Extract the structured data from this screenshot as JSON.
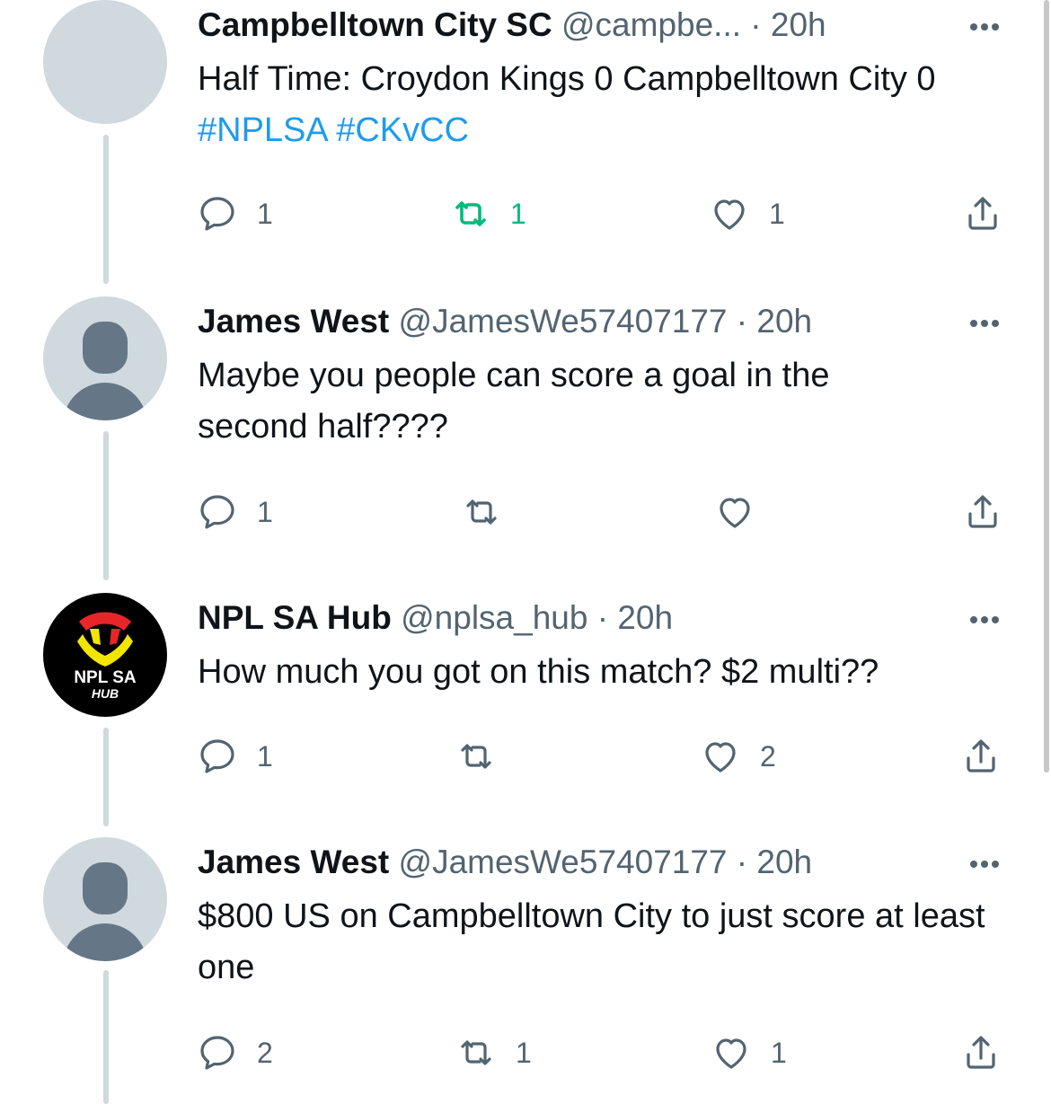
{
  "tweets": [
    {
      "name": "Campbelltown City SC",
      "handle": "@campbe...",
      "dot": "·",
      "time": "20h",
      "text_plain": "Half Time: Croydon Kings 0 Campbelltown City 0",
      "hashtag1": "#NPLSA",
      "hashtag2": "#CKvCC",
      "avatar": "blank",
      "reply_count": "1",
      "retweet_count": "1",
      "like_count": "1",
      "retweeted": true
    },
    {
      "name": "James West",
      "handle": "@JamesWe57407177",
      "dot": "·",
      "time": "20h",
      "text": "Maybe you people can score a goal in the second half????",
      "avatar": "default-profile",
      "reply_count": "1",
      "retweet_count": "",
      "like_count": ""
    },
    {
      "name": "NPL SA Hub",
      "handle": "@nplsa_hub",
      "dot": "·",
      "time": "20h",
      "text": "How much you got on this match? $2 multi??",
      "avatar": "npl-sa-hub-logo",
      "logo_line1": "NPL SA",
      "logo_line2": "HUB",
      "reply_count": "1",
      "retweet_count": "",
      "like_count": "2"
    },
    {
      "name": "James West",
      "handle": "@JamesWe57407177",
      "dot": "·",
      "time": "20h",
      "text": "$800 US on Campbelltown City to just score at least one",
      "avatar": "default-profile",
      "reply_count": "2",
      "retweet_count": "1",
      "like_count": "1"
    }
  ],
  "colors": {
    "text": "#0f1419",
    "secondary": "#536471",
    "link": "#1d9bf0",
    "retweet_active": "#00ba7c",
    "thread_line": "#cfd9de"
  }
}
